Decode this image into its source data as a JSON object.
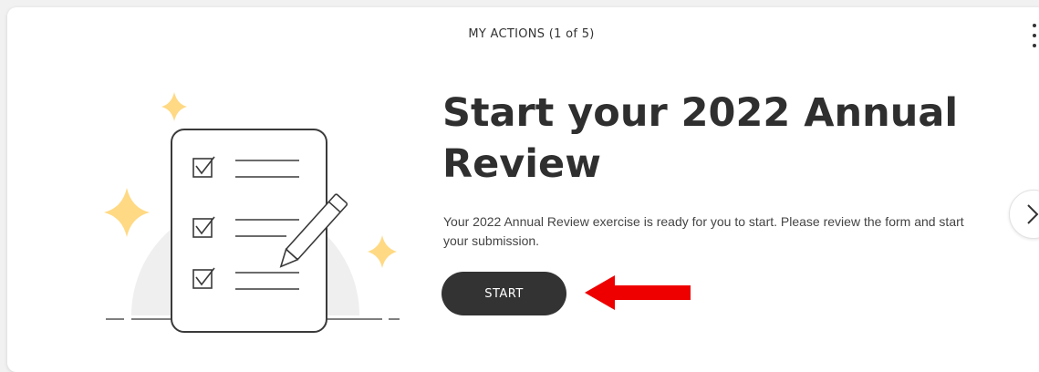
{
  "card": {
    "header": "MY ACTIONS (1 of 5)",
    "title": "Start your 2022 Annual Review",
    "description": "Your 2022 Annual Review exercise is ready for you to start. Please review the form and start your submission.",
    "start_label": "START"
  },
  "icons": {
    "more": "more-vertical-icon",
    "next": "chevron-right-icon",
    "illustration": "checklist-with-pencil-illustration",
    "annotation": "red-arrow-pointing-left"
  },
  "colors": {
    "button_bg": "#333333",
    "title": "#2f2f2f",
    "sparkle": "#ffd983",
    "arrow": "#ee0000"
  }
}
